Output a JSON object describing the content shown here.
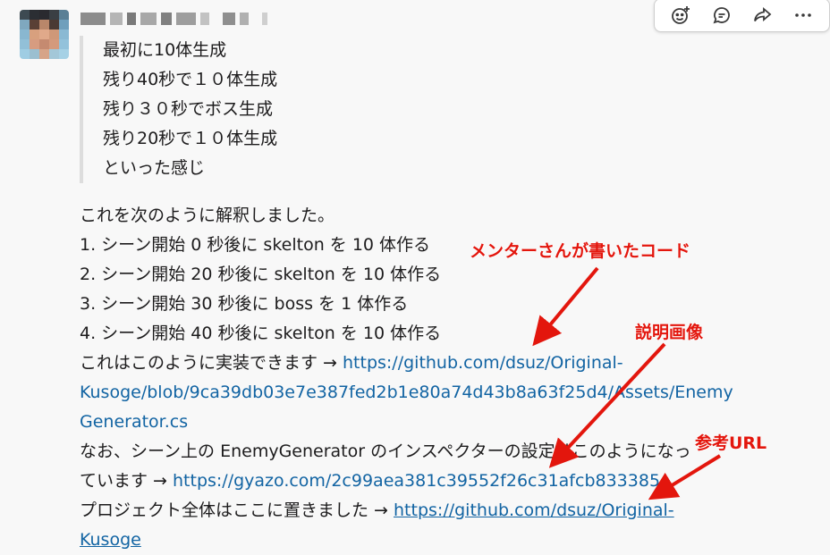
{
  "message": {
    "quote_lines": [
      "最初に10体生成",
      "残り40秒で１０体生成",
      "残り３０秒でボス生成",
      "残り20秒で１０体生成",
      "といった感じ"
    ],
    "intro": "これを次のように解釈しました。",
    "list": [
      "1. シーン開始 0 秒後に skelton を 10 体作る",
      "2. シーン開始 20 秒後に skelton を 10 体作る",
      "3. シーン開始 30 秒後に boss を 1 体作る",
      "4. シーン開始 40 秒後に skelton を 10 体作る"
    ],
    "impl_prefix": "これはこのように実装できます → ",
    "impl_link_line1": "https://github.com/dsuz/Original-",
    "impl_link_line2": "Kusoge/blob/9ca39db03e7e387fed2b1e80a74d43b8a63f25d4/Assets/Enemy",
    "impl_link_line3": "Generator.cs",
    "inspector_line1": "なお、シーン上の EnemyGenerator のインスペクターの設定はこのようになっ",
    "inspector_prefix": "ています → ",
    "inspector_link": "https://gyazo.com/2c99aea381c39552f26c31afcb833385",
    "project_prefix": "プロジェクト全体はここに置きました → ",
    "project_link_line1": "https://github.com/dsuz/Original-",
    "project_link_line2": "Kusoge"
  },
  "annotations": {
    "mentor_code": "メンターさんが書いたコード",
    "explain_image": "説明画像",
    "reference_url": "参考URL"
  },
  "colors": {
    "link": "#1264a3",
    "annotation": "#e3160d"
  },
  "toolbar": {
    "icons": [
      "add-reaction-icon",
      "reply-in-thread-icon",
      "share-icon",
      "more-actions-icon"
    ]
  }
}
